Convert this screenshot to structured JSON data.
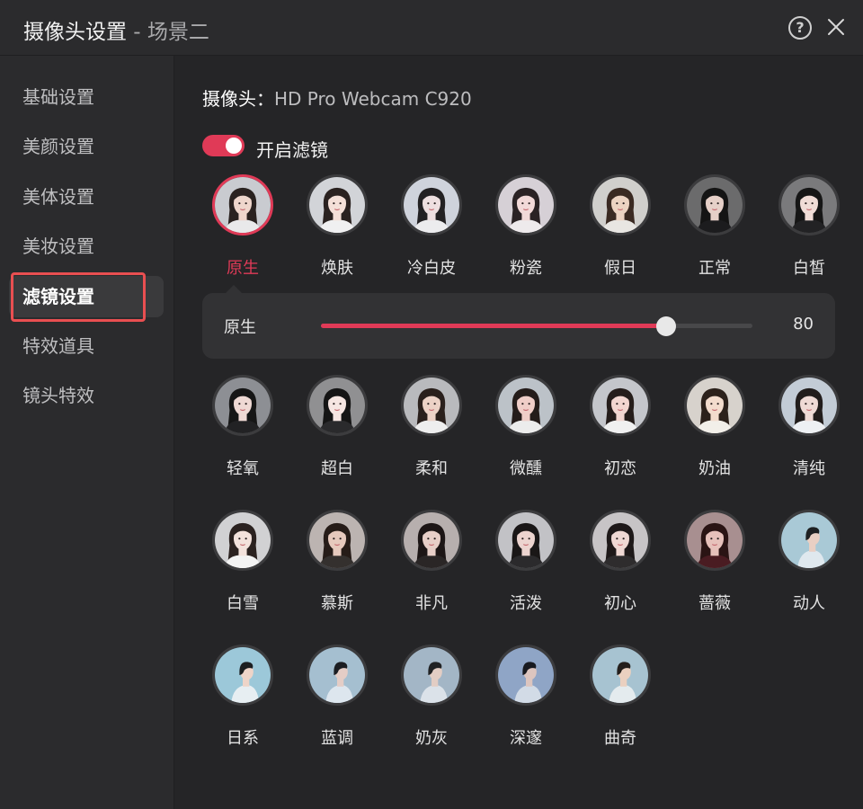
{
  "window": {
    "title": "摄像头设置",
    "subtitle": " - 场景二",
    "help_glyph": "?"
  },
  "sidebar": {
    "items": [
      {
        "label": "基础设置"
      },
      {
        "label": "美颜设置"
      },
      {
        "label": "美体设置"
      },
      {
        "label": "美妆设置"
      },
      {
        "label": "滤镜设置",
        "active": true
      },
      {
        "label": "特效道具"
      },
      {
        "label": "镜头特效"
      }
    ]
  },
  "main": {
    "camera_prefix": "摄像头：",
    "camera_name": "HD Pro Webcam C920",
    "toggle_label": "开启滤镜",
    "toggle_on": true,
    "accent_color": "#e03a57",
    "filters": [
      {
        "label": "原生",
        "selected": true,
        "bg": "#c9cbd0",
        "hair": "#2a2220",
        "skin": "#efd6cc",
        "shirt": "#e9e9ea"
      },
      {
        "label": "焕肤",
        "bg": "#d2d4d8",
        "hair": "#2a2220",
        "skin": "#f4e0d8",
        "shirt": "#f0f0f1"
      },
      {
        "label": "冷白皮",
        "bg": "#cfd3dc",
        "hair": "#232123",
        "skin": "#eedfe0",
        "shirt": "#ececee"
      },
      {
        "label": "粉瓷",
        "bg": "#d6d0d6",
        "hair": "#2a2224",
        "skin": "#f2d9d8",
        "shirt": "#eeeaec"
      },
      {
        "label": "假日",
        "bg": "#d0cfcc",
        "hair": "#3a2a22",
        "skin": "#ecd3c2",
        "shirt": "#e8e6e2"
      },
      {
        "label": "正常",
        "bg": "#6b6b6c",
        "hair": "#141414",
        "skin": "#e6d0c8",
        "shirt": "#1c1c1e"
      },
      {
        "label": "白皙",
        "bg": "#7a7a7c",
        "hair": "#161616",
        "skin": "#f0dcd6",
        "shirt": "#222224"
      },
      {
        "label": "轻氧",
        "bg": "#8d8f94",
        "hair": "#161616",
        "skin": "#efd9d4",
        "shirt": "#222224"
      },
      {
        "label": "超白",
        "bg": "#909092",
        "hair": "#151515",
        "skin": "#f6e6e2",
        "shirt": "#2a2a2c"
      },
      {
        "label": "柔和",
        "bg": "#b9babd",
        "hair": "#2a201c",
        "skin": "#ecd2c6",
        "shirt": "#eeeeee"
      },
      {
        "label": "微醺",
        "bg": "#bcc2c8",
        "hair": "#241c1a",
        "skin": "#f0cec8",
        "shirt": "#ececec"
      },
      {
        "label": "初恋",
        "bg": "#c4c6cb",
        "hair": "#251d1b",
        "skin": "#f2d6d0",
        "shirt": "#f0f0f0"
      },
      {
        "label": "奶油",
        "bg": "#d7d2cc",
        "hair": "#2c211b",
        "skin": "#f3dccd",
        "shirt": "#f2efe9"
      },
      {
        "label": "清纯",
        "bg": "#c3ccd6",
        "hair": "#221d1c",
        "skin": "#efdad5",
        "shirt": "#eef0f3"
      },
      {
        "label": "白雪",
        "bg": "#d1d1d3",
        "hair": "#2b2220",
        "skin": "#f3e2dc",
        "shirt": "#f3f3f3"
      },
      {
        "label": "慕斯",
        "bg": "#bcb4b1",
        "hair": "#261c18",
        "skin": "#e6c9bd",
        "shirt": "#34302e"
      },
      {
        "label": "非凡",
        "bg": "#b7afae",
        "hair": "#1d1616",
        "skin": "#e8cfc8",
        "shirt": "#2a2626"
      },
      {
        "label": "活泼",
        "bg": "#c2c2c6",
        "hair": "#1a1717",
        "skin": "#ecd4cf",
        "shirt": "#2b2a2c"
      },
      {
        "label": "初心",
        "bg": "#c7c4c6",
        "hair": "#1e1919",
        "skin": "#efd8d3",
        "shirt": "#2e2c2d"
      },
      {
        "label": "蔷薇",
        "bg": "#a88f90",
        "hair": "#2a1414",
        "skin": "#e7c1bb",
        "shirt": "#4a1c22"
      },
      {
        "label": "动人",
        "bg": "#a9c9d6",
        "hair": "#1e2022",
        "skin": "#e9cfc3",
        "shirt": "#dfe8ee",
        "profile": true
      },
      {
        "label": "日系",
        "bg": "#9cc8d9",
        "hair": "#1c1e20",
        "skin": "#eed4c8",
        "shirt": "#e7eef2",
        "profile": true
      },
      {
        "label": "蓝调",
        "bg": "#a5bfd0",
        "hair": "#1c1e22",
        "skin": "#e4cdc6",
        "shirt": "#dde6ee",
        "profile": true
      },
      {
        "label": "奶灰",
        "bg": "#a3b6c6",
        "hair": "#202224",
        "skin": "#e2cdc4",
        "shirt": "#dbe2e9",
        "profile": true
      },
      {
        "label": "深邃",
        "bg": "#8fa5c6",
        "hair": "#181a20",
        "skin": "#dcc5bf",
        "shirt": "#d2dbe6",
        "profile": true
      },
      {
        "label": "曲奇",
        "bg": "#a7c3d1",
        "hair": "#241f1c",
        "skin": "#ead0c0",
        "shirt": "#e4ebee",
        "profile": true
      }
    ],
    "slider": {
      "label": "原生",
      "value": 80,
      "fill_fraction": 0.8
    }
  }
}
